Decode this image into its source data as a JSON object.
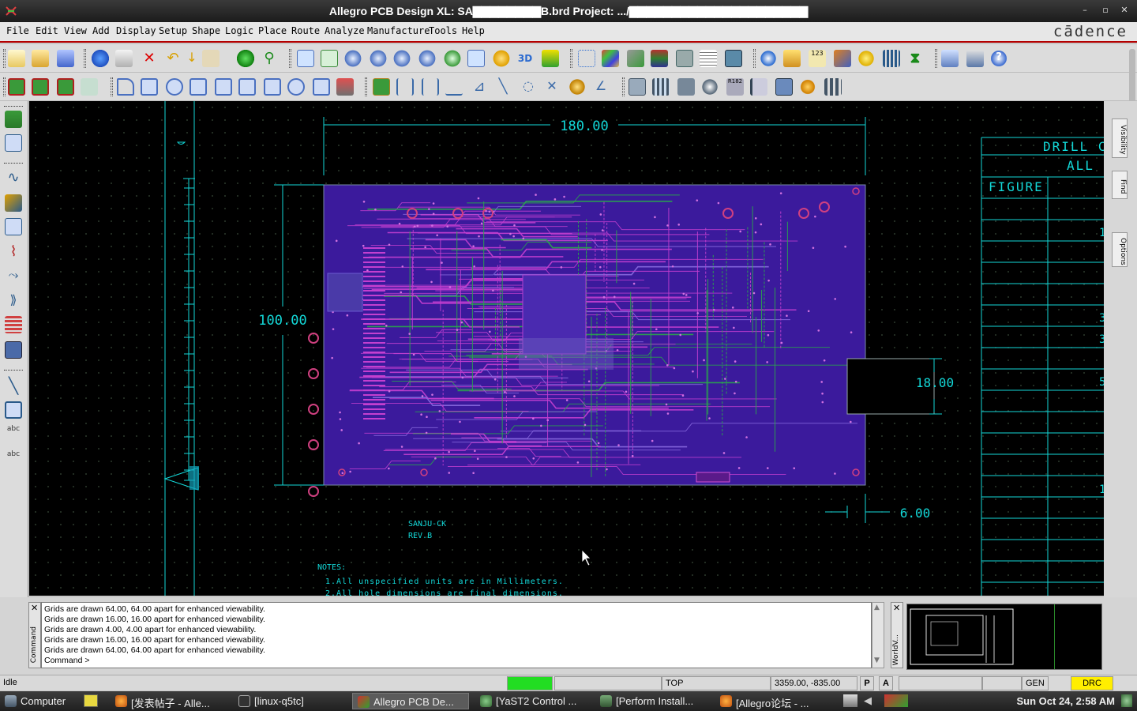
{
  "window": {
    "title": "Allegro PCB Design XL: SA▇▇▇▇▇▇▇▇B.brd  Project: .../▇▇▇▇▇▇▇▇▇▇▇▇▇▇▇▇▇▇▇▇▇",
    "minimize": "–",
    "maximize": "▫",
    "close": "✕"
  },
  "menu": {
    "items": [
      "File",
      "Edit",
      "View",
      "Add",
      "Display",
      "Setup",
      "Shape",
      "Logic",
      "Place",
      "Route",
      "Analyze",
      "Manufacture",
      "Tools",
      "Help"
    ],
    "brand": "cādence"
  },
  "drawing": {
    "dim_width": "180.00",
    "dim_height": "100.00",
    "dim_notch": "18.00",
    "dim_offset": "6.00",
    "board_name": "SANJU-CK",
    "board_rev": "REV.B",
    "notes_title": "NOTES:",
    "note1": "1.All unspecified units are in Millimeters.",
    "note2": "2.All hole dimensions are final dimensions.",
    "drill_header": "DRILL C",
    "drill_sub": "ALL",
    "figure_header": "FIGURE",
    "table_marks": [
      "1",
      "3",
      "3",
      "5",
      "1"
    ],
    "colors": {
      "cad_lines": "#13d8d8",
      "board_fill": "#3b1a9c",
      "trace_magenta": "#c43fd0",
      "trace_green": "#2aa84a"
    }
  },
  "right_tabs": [
    "Visibility",
    "Find",
    "Options"
  ],
  "console": {
    "side_label": "Command",
    "lines": [
      "Grids are drawn 64.00, 64.00 apart for enhanced viewability.",
      "Grids are drawn 16.00, 16.00 apart for enhanced viewability.",
      "Grids are drawn 4.00, 4.00 apart for enhanced viewability.",
      "Grids are drawn 16.00, 16.00 apart for enhanced viewability.",
      "Grids are drawn 64.00, 64.00 apart for enhanced viewability.",
      "Command >"
    ]
  },
  "worldview": {
    "side_label": "WorldV..."
  },
  "status": {
    "state": "Idle",
    "layer": "TOP",
    "coords": "3359.00, -835.00",
    "p_button": "P",
    "a_button": "A",
    "mode": "GEN",
    "drc": "DRC",
    "indicator_color": "#22dd22",
    "drc_color": "#ffee00"
  },
  "taskbar": {
    "start": "Computer",
    "tasks": [
      "[发表帖子 - Alle...",
      "[linux-q5tc]",
      "Allegro PCB De...",
      "[YaST2 Control ...",
      "[Perform Install...",
      "[Allegro论坛 - ..."
    ],
    "clock": "Sun Oct 24,  2:58 AM"
  }
}
